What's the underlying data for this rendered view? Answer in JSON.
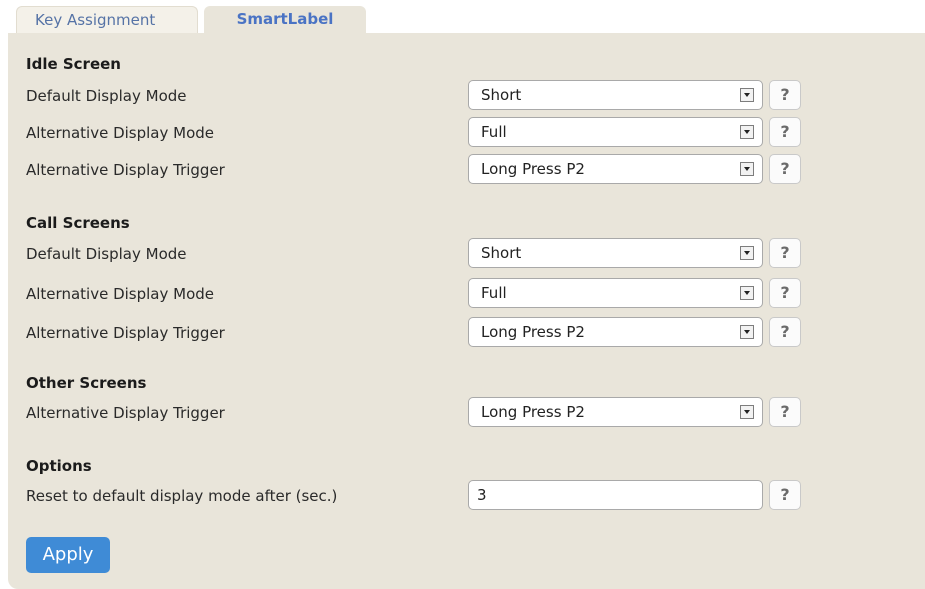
{
  "tabs": [
    {
      "label": "Key Assignment",
      "active": false
    },
    {
      "label": "SmartLabel",
      "active": true
    }
  ],
  "sections": {
    "idle": {
      "title": "Idle Screen",
      "rows": [
        {
          "label": "Default Display Mode",
          "value": "Short"
        },
        {
          "label": "Alternative Display Mode",
          "value": "Full"
        },
        {
          "label": "Alternative Display Trigger",
          "value": "Long Press P2"
        }
      ]
    },
    "call": {
      "title": "Call Screens",
      "rows": [
        {
          "label": "Default Display Mode",
          "value": "Short"
        },
        {
          "label": "Alternative Display Mode",
          "value": "Full"
        },
        {
          "label": "Alternative Display Trigger",
          "value": "Long Press P2"
        }
      ]
    },
    "other": {
      "title": "Other Screens",
      "rows": [
        {
          "label": "Alternative Display Trigger",
          "value": "Long Press P2"
        }
      ]
    },
    "options": {
      "title": "Options",
      "rows": [
        {
          "label": "Reset to default display mode after (sec.)",
          "value": "3"
        }
      ]
    }
  },
  "help_label": "?",
  "apply_label": "Apply",
  "colors": {
    "panel_bg": "#e9e5da",
    "tab_active_text": "#4a73c4",
    "tab_inactive_text": "#5673a6",
    "apply_bg": "#3f8bd6"
  }
}
